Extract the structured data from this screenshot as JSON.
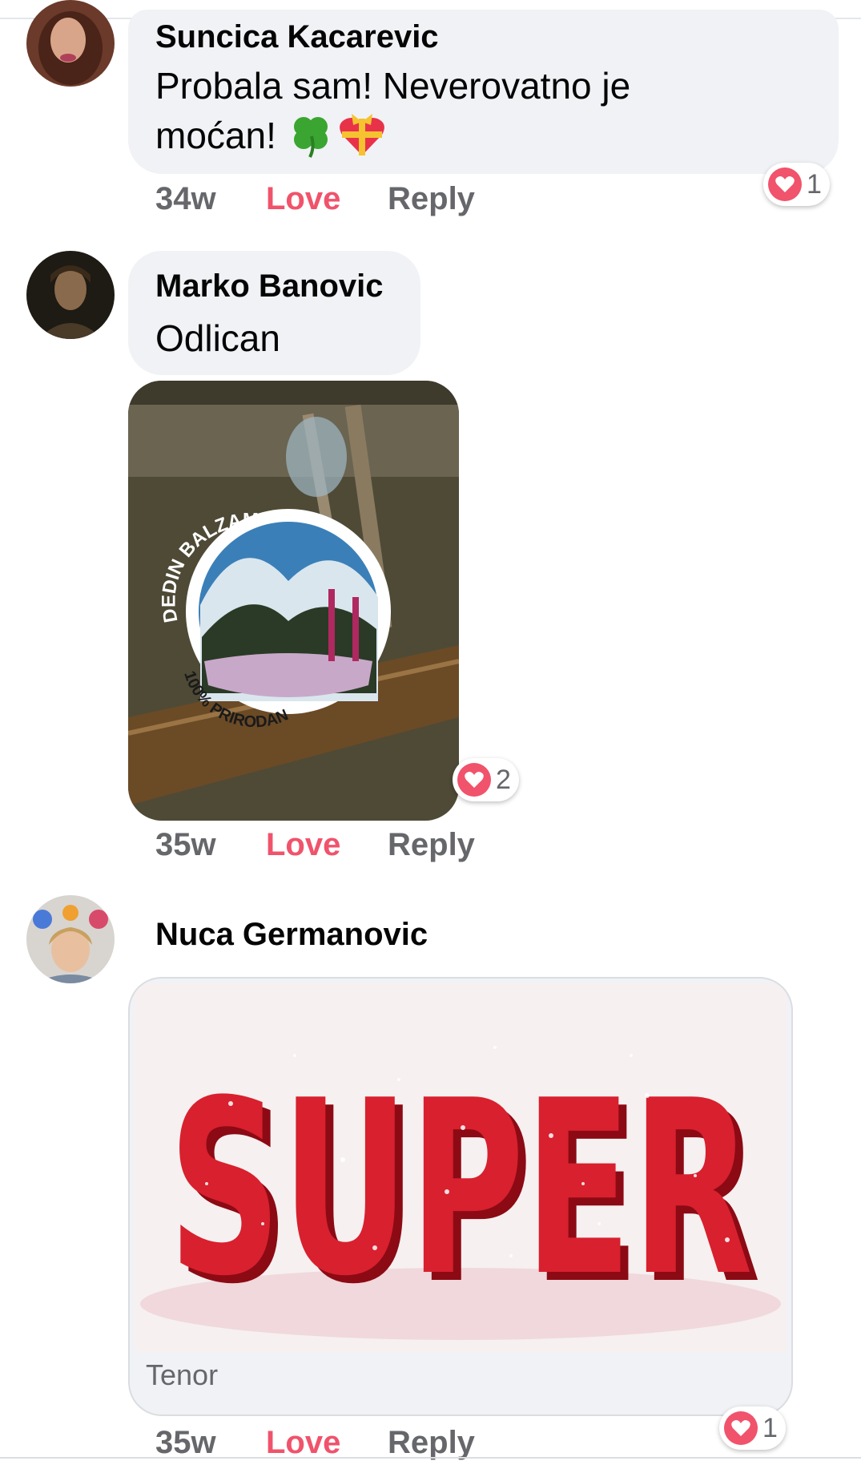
{
  "comments": [
    {
      "author": "Suncica Kacarevic",
      "text_line1": "Probala sam! Neverovatno je",
      "text_line2": "moćan!",
      "emoji": [
        "four-leaf-clover",
        "heart-with-ribbon"
      ],
      "time": "34w",
      "love": "Love",
      "reply": "Reply",
      "reaction_count": "1"
    },
    {
      "author": "Marko Banovic",
      "text": "Odlican",
      "photo_label_top": "DEDIN BALZAM",
      "photo_label_bottom": "100% PRIRODAN",
      "time": "35w",
      "love": "Love",
      "reply": "Reply",
      "reaction_count": "2"
    },
    {
      "author": "Nuca Germanovic",
      "gif_word": "SUPER",
      "gif_source": "Tenor",
      "time": "35w",
      "love": "Love",
      "reply": "Reply",
      "reaction_count": "1"
    }
  ],
  "colors": {
    "love": "#f0536b",
    "bubble": "#f0f2f5",
    "meta": "#65676b"
  }
}
